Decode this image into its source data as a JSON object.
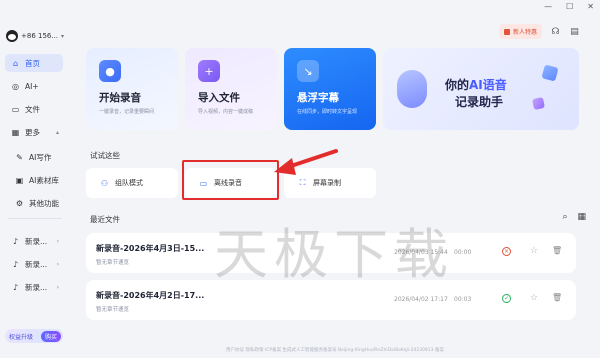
{
  "user": {
    "phone": "+86 156..."
  },
  "sidebar": {
    "items": [
      {
        "label": "首页",
        "icon": "home-icon"
      },
      {
        "label": "AI+",
        "icon": "ai-plus-icon"
      },
      {
        "label": "文件",
        "icon": "file-icon"
      },
      {
        "label": "更多",
        "icon": "more-icon"
      },
      {
        "label": "AI写作",
        "icon": "ai-write-icon"
      },
      {
        "label": "AI素材库",
        "icon": "ai-library-icon"
      },
      {
        "label": "其他功能",
        "icon": "other-icon"
      },
      {
        "label": "新录...",
        "icon": "mic-icon"
      },
      {
        "label": "新录...",
        "icon": "mic-icon"
      },
      {
        "label": "新录...",
        "icon": "mic-icon"
      }
    ],
    "upgrade_label": "权益升级",
    "buy_label": "购买"
  },
  "topbar": {
    "gift_label": "新人特惠"
  },
  "cards": [
    {
      "title": "开始录音",
      "sub": "一键录音，记录重要瞬间"
    },
    {
      "title": "导入文件",
      "sub": "导入视频，内容一键成稿"
    },
    {
      "title": "悬浮字幕",
      "sub": "在线同步，即时转文字呈现"
    }
  ],
  "banner": {
    "line1_prefix": "你的",
    "line1_ai": "AI语音",
    "line2": "记录助手"
  },
  "try_section": {
    "title": "试试这些",
    "items": [
      {
        "label": "组队模式"
      },
      {
        "label": "离线录音"
      },
      {
        "label": "屏幕录制"
      }
    ]
  },
  "recent": {
    "title": "最近文件",
    "files": [
      {
        "name": "新录音-2026年4月3日-15...",
        "desc": "暂无章节速览",
        "date": "2026/04/03 15:44",
        "duration": "00:00",
        "status": "failed"
      },
      {
        "name": "新录音-2026年4月2日-17...",
        "desc": "暂无章节速览",
        "date": "2026/04/02 17:17",
        "duration": "00:03",
        "status": "ok"
      }
    ]
  },
  "footer": "用户协议 隐私政策 ICP备案 生成式人工智能服务备案号 Beijing-XingHuoPinZhiDaiBoKeJi-20230913 备案",
  "watermark": "天极下载",
  "colors": {
    "accent": "#3b6cf5",
    "highlight_box": "#e32d2d"
  }
}
